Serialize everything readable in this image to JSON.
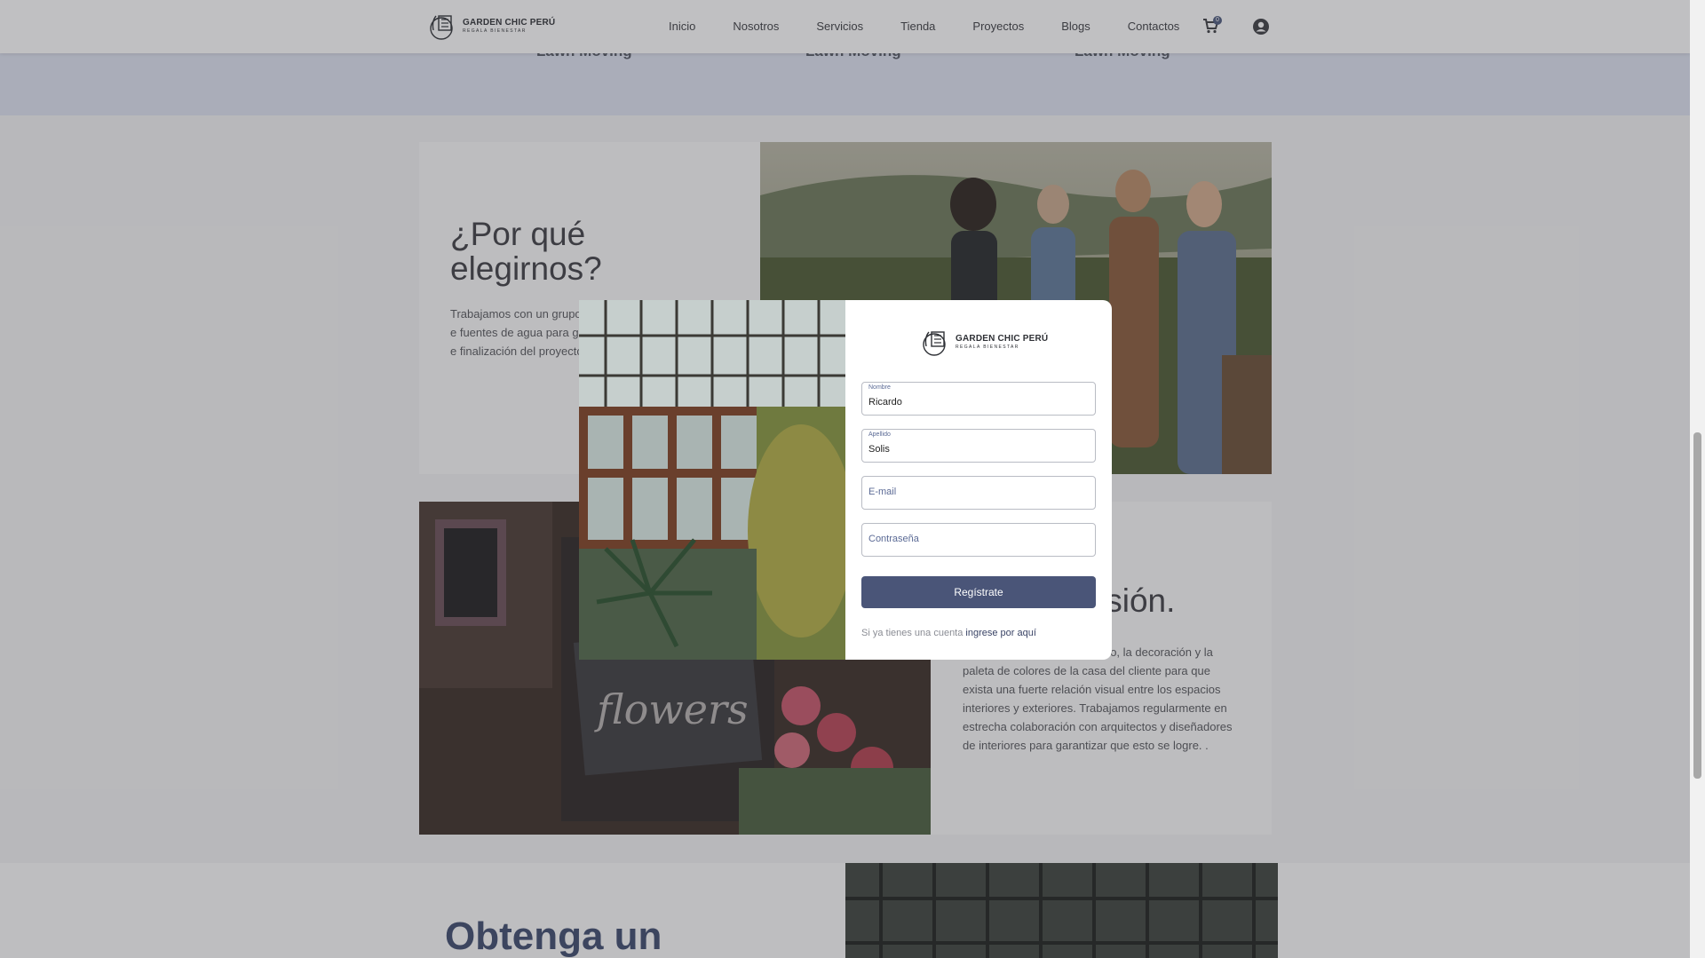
{
  "brand": {
    "name": "GARDEN CHIC PERÚ",
    "tagline": "REGALA BIENESTAR"
  },
  "nav": {
    "items": [
      "Inicio",
      "Nosotros",
      "Servicios",
      "Tienda",
      "Proyectos",
      "Blogs",
      "Contactos"
    ],
    "cart_count": "0"
  },
  "services": {
    "labels": [
      "Lawn Moving",
      "Lawn Moving",
      "Lawn Moving"
    ]
  },
  "why": {
    "title_line1": "¿Por qué",
    "title_line2": "elegirnos?",
    "text": "Trabajamos con un grupo paisajismo, especialistas e fuentes de agua para gar diseño del jardín, desde e finalización del proyecto, inconvenientes."
  },
  "vision": {
    "title": "isión.",
    "text": "más fielmente posible el estilo, la decoración y la paleta de colores de la casa del cliente para que exista una fuerte relación visual entre los espacios interiores y exteriores. Trabajamos regularmente en estrecha colaboración con arquitectos y diseñadores de interiores para garantizar que esto se logre. ."
  },
  "bottom": {
    "heading": "Obtenga un"
  },
  "modal": {
    "nombre_label": "Nombre",
    "nombre_value": "Ricardo",
    "apellido_label": "Apellido",
    "apellido_value": "Solis",
    "email_placeholder": "E-mail",
    "password_placeholder": "Contraseña",
    "submit_label": "Regístrate",
    "login_prefix": "Si ya tienes una cuenta",
    "login_link": "ingrese por aquí"
  },
  "colors": {
    "primary": "#4a5578",
    "band": "#dfe4f2",
    "heading_blue": "#3d4a6e"
  }
}
